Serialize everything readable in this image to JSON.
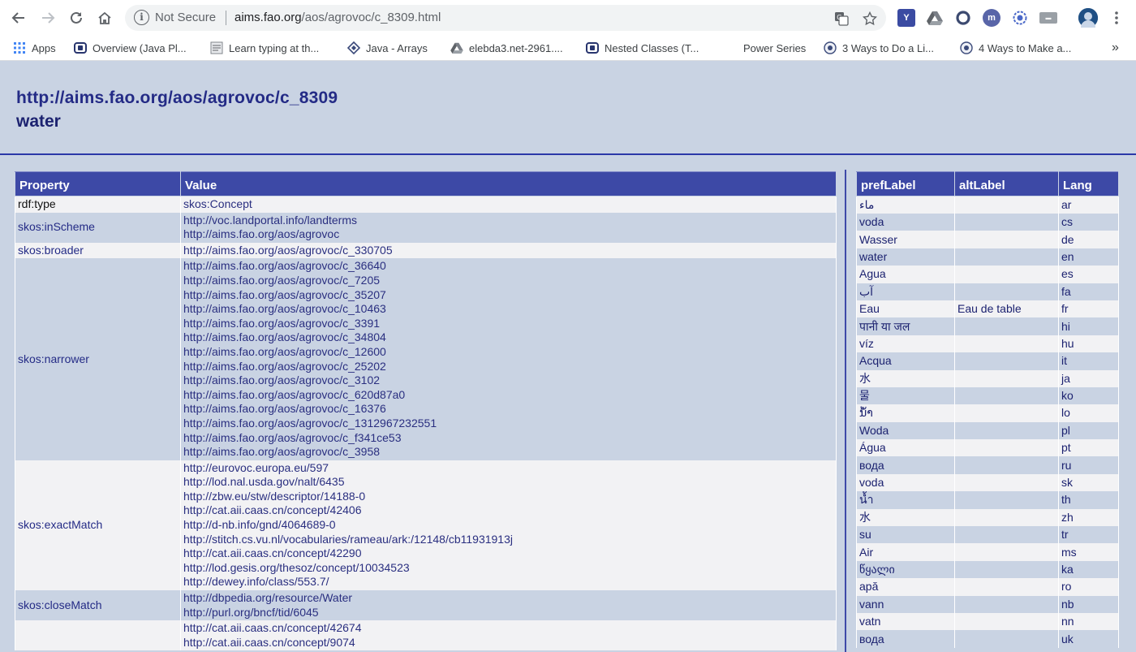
{
  "browser": {
    "security_label": "Not Secure",
    "url_host": "aims.fao.org",
    "url_path": "/aos/agrovoc/c_8309.html",
    "bookmarks": [
      {
        "label": "Apps",
        "icon": "apps-grid-icon"
      },
      {
        "label": "Overview (Java Pl...",
        "icon": "java-doc-icon"
      },
      {
        "label": "Learn typing at th...",
        "icon": "typing-icon"
      },
      {
        "label": "Java - Arrays",
        "icon": "tutorial-icon"
      },
      {
        "label": "elebda3.net-2961....",
        "icon": "drive-icon"
      },
      {
        "label": "Nested Classes (T...",
        "icon": "java-doc-icon"
      },
      {
        "label": "Power Series",
        "icon": "blank-icon"
      },
      {
        "label": "3 Ways to Do a Li...",
        "icon": "wikihow-icon"
      },
      {
        "label": "4 Ways to Make a...",
        "icon": "wikihow-icon"
      }
    ],
    "more_bookmarks": "»"
  },
  "header": {
    "uri": "http://aims.fao.org/aos/agrovoc/c_8309",
    "label": "water"
  },
  "properties": {
    "columns": [
      "Property",
      "Value"
    ],
    "rows": [
      {
        "property": "rdf:type",
        "values": [
          "skos:Concept"
        ]
      },
      {
        "property": "skos:inScheme",
        "values": [
          "http://voc.landportal.info/landterms",
          "http://aims.fao.org/aos/agrovoc"
        ]
      },
      {
        "property": "skos:broader",
        "values": [
          "http://aims.fao.org/aos/agrovoc/c_330705"
        ]
      },
      {
        "property": "skos:narrower",
        "values": [
          "http://aims.fao.org/aos/agrovoc/c_36640",
          "http://aims.fao.org/aos/agrovoc/c_7205",
          "http://aims.fao.org/aos/agrovoc/c_35207",
          "http://aims.fao.org/aos/agrovoc/c_10463",
          "http://aims.fao.org/aos/agrovoc/c_3391",
          "http://aims.fao.org/aos/agrovoc/c_34804",
          "http://aims.fao.org/aos/agrovoc/c_12600",
          "http://aims.fao.org/aos/agrovoc/c_25202",
          "http://aims.fao.org/aos/agrovoc/c_3102",
          "http://aims.fao.org/aos/agrovoc/c_620d87a0",
          "http://aims.fao.org/aos/agrovoc/c_16376",
          "http://aims.fao.org/aos/agrovoc/c_1312967232551",
          "http://aims.fao.org/aos/agrovoc/c_f341ce53",
          "http://aims.fao.org/aos/agrovoc/c_3958"
        ]
      },
      {
        "property": "skos:exactMatch",
        "values": [
          "http://eurovoc.europa.eu/597",
          "http://lod.nal.usda.gov/nalt/6435",
          "http://zbw.eu/stw/descriptor/14188-0",
          "http://cat.aii.caas.cn/concept/42406",
          "http://d-nb.info/gnd/4064689-0",
          "http://stitch.cs.vu.nl/vocabularies/rameau/ark:/12148/cb11931913j",
          "http://cat.aii.caas.cn/concept/42290",
          "http://lod.gesis.org/thesoz/concept/10034523",
          "http://dewey.info/class/553.7/"
        ]
      },
      {
        "property": "skos:closeMatch",
        "values": [
          "http://dbpedia.org/resource/Water",
          "http://purl.org/bncf/tid/6045"
        ]
      },
      {
        "property": "",
        "values": [
          "http://cat.aii.caas.cn/concept/42674",
          "http://cat.aii.caas.cn/concept/9074"
        ]
      }
    ]
  },
  "labels": {
    "columns": [
      "prefLabel",
      "altLabel",
      "Lang"
    ],
    "rows": [
      {
        "pref": "ماء",
        "alt": "",
        "lang": "ar"
      },
      {
        "pref": "voda",
        "alt": "",
        "lang": "cs"
      },
      {
        "pref": "Wasser",
        "alt": "",
        "lang": "de"
      },
      {
        "pref": "water",
        "alt": "",
        "lang": "en"
      },
      {
        "pref": "Agua",
        "alt": "",
        "lang": "es"
      },
      {
        "pref": "آب",
        "alt": "",
        "lang": "fa"
      },
      {
        "pref": "Eau",
        "alt": "Eau de table",
        "lang": "fr"
      },
      {
        "pref": "पानी या जल",
        "alt": "",
        "lang": "hi"
      },
      {
        "pref": "víz",
        "alt": "",
        "lang": "hu"
      },
      {
        "pref": "Acqua",
        "alt": "",
        "lang": "it"
      },
      {
        "pref": "水",
        "alt": "",
        "lang": "ja"
      },
      {
        "pref": "물",
        "alt": "",
        "lang": "ko"
      },
      {
        "pref": "ນ້ຳ",
        "alt": "",
        "lang": "lo"
      },
      {
        "pref": "Woda",
        "alt": "",
        "lang": "pl"
      },
      {
        "pref": "Água",
        "alt": "",
        "lang": "pt"
      },
      {
        "pref": "вода",
        "alt": "",
        "lang": "ru"
      },
      {
        "pref": "voda",
        "alt": "",
        "lang": "sk"
      },
      {
        "pref": "น้ำ",
        "alt": "",
        "lang": "th"
      },
      {
        "pref": "水",
        "alt": "",
        "lang": "zh"
      },
      {
        "pref": "su",
        "alt": "",
        "lang": "tr"
      },
      {
        "pref": "Air",
        "alt": "",
        "lang": "ms"
      },
      {
        "pref": "წყალი",
        "alt": "",
        "lang": "ka"
      },
      {
        "pref": "apă",
        "alt": "",
        "lang": "ro"
      },
      {
        "pref": "vann",
        "alt": "",
        "lang": "nb"
      },
      {
        "pref": "vatn",
        "alt": "",
        "lang": "nn"
      },
      {
        "pref": "вода",
        "alt": "",
        "lang": "uk"
      }
    ]
  },
  "colors": {
    "page_background": "#c9d3e3",
    "header_text": "#242b86",
    "table_header": "#3d49a6",
    "row_light": "#f2f2f4"
  }
}
